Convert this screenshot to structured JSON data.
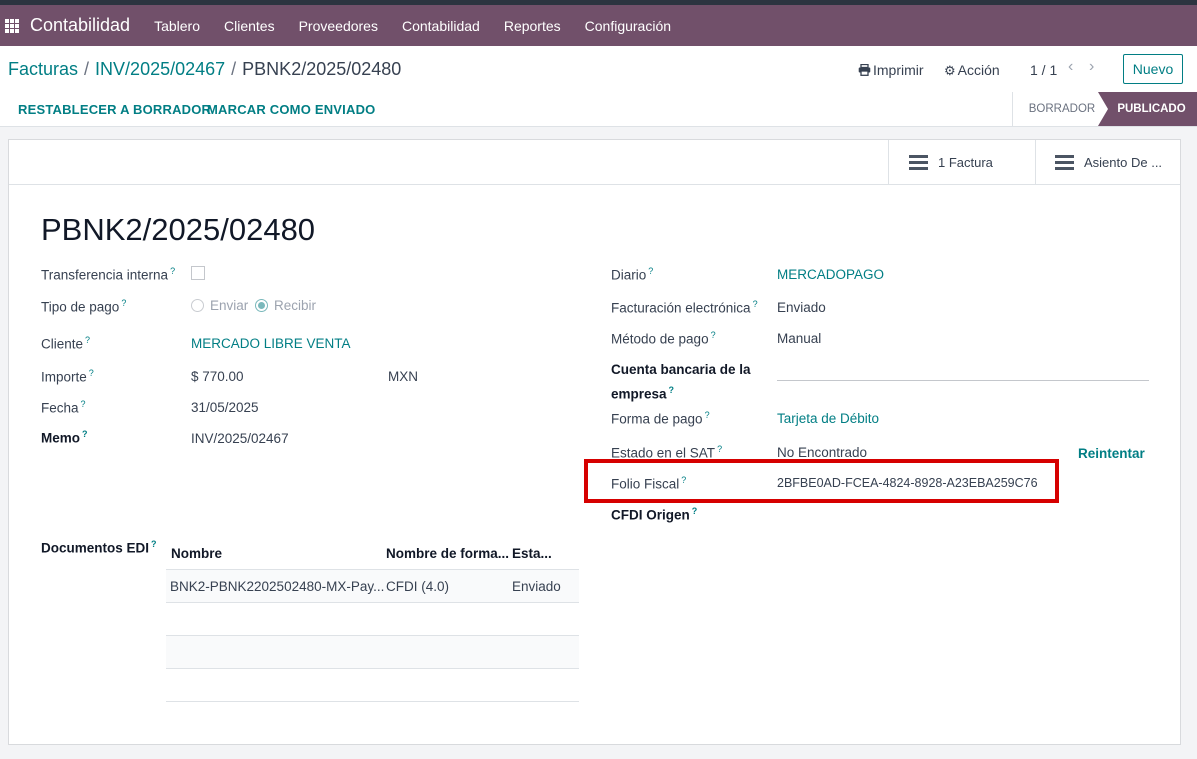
{
  "navbar": {
    "brand": "Contabilidad",
    "menu": [
      "Tablero",
      "Clientes",
      "Proveedores",
      "Contabilidad",
      "Reportes",
      "Configuración"
    ]
  },
  "breadcrumb": {
    "items": [
      "Facturas",
      "INV/2025/02467"
    ],
    "current": "PBNK2/2025/02480"
  },
  "controls": {
    "print": "Imprimir",
    "action": "Acción",
    "pager": "1 / 1",
    "new": "Nuevo"
  },
  "statusbar": {
    "reset_draft": "RESTABLECER A BORRADOR",
    "mark_sent": "MARCAR COMO ENVIADO",
    "stages": [
      "BORRADOR",
      "PUBLICADO"
    ],
    "active_stage": "PUBLICADO"
  },
  "smart_buttons": [
    "1 Factura",
    "Asiento De ..."
  ],
  "record": {
    "title": "PBNK2/2025/02480",
    "left": {
      "internal_transfer_label": "Transferencia interna",
      "payment_type_label": "Tipo de pago",
      "payment_type_options": [
        "Enviar",
        "Recibir"
      ],
      "payment_type_selected": "Recibir",
      "customer_label": "Cliente",
      "customer": "MERCADO LIBRE VENTA",
      "amount_label": "Importe",
      "amount": "$ 770.00",
      "currency": "MXN",
      "date_label": "Fecha",
      "date": "31/05/2025",
      "memo_label": "Memo",
      "memo": "INV/2025/02467"
    },
    "right": {
      "journal_label": "Diario",
      "journal": "MERCADOPAGO",
      "einvoice_label": "Facturación electrónica",
      "einvoice": "Enviado",
      "payment_method_label": "Método de pago",
      "payment_method": "Manual",
      "bank_account_label_1": "Cuenta bancaria de la",
      "bank_account_label_2": "empresa",
      "payment_way_label": "Forma de pago",
      "payment_way": "Tarjeta de Débito",
      "sat_status_label": "Estado en el SAT",
      "sat_status": "No Encontrado",
      "retry": "Reintentar",
      "fiscal_folio_label": "Folio Fiscal",
      "fiscal_folio": "2BFBE0AD-FCEA-4824-8928-A23EBA259C76",
      "cfdi_origin_label": "CFDI Origen"
    },
    "edi": {
      "label": "Documentos EDI",
      "columns": [
        "Nombre",
        "Nombre de forma...",
        "Esta..."
      ],
      "rows": [
        [
          "BNK2-PBNK2202502480-MX-Pay...",
          "CFDI (4.0)",
          "Enviado"
        ]
      ]
    },
    "help_mark": "?"
  }
}
